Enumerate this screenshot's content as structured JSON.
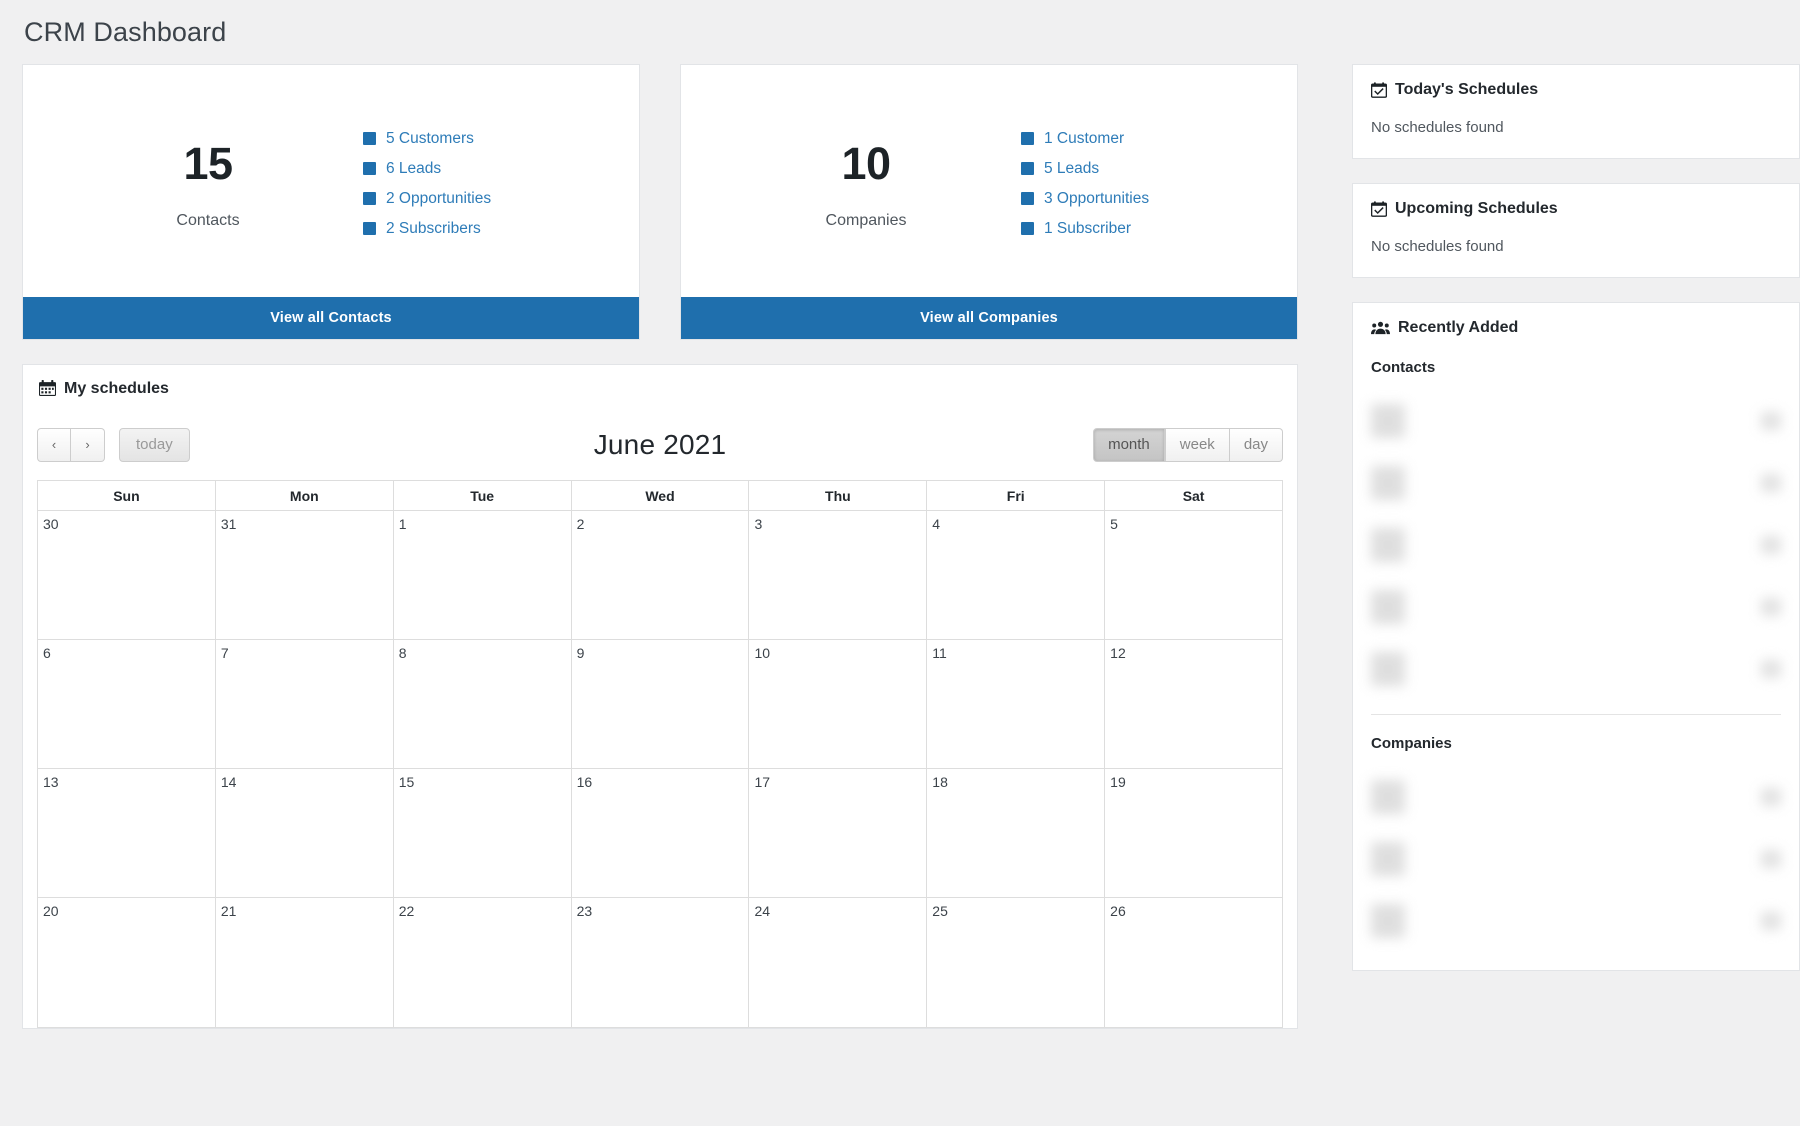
{
  "page": {
    "title": "CRM Dashboard"
  },
  "stats": [
    {
      "id": "contacts",
      "number": "15",
      "label": "Contacts",
      "legend": [
        {
          "text": "5 Customers",
          "color": "#1f6fad"
        },
        {
          "text": "6 Leads",
          "color": "#1f6fad"
        },
        {
          "text": "2 Opportunities",
          "color": "#1f6fad"
        },
        {
          "text": "2 Subscribers",
          "color": "#1f6fad"
        }
      ],
      "footer_label": "View all Contacts"
    },
    {
      "id": "companies",
      "number": "10",
      "label": "Companies",
      "legend": [
        {
          "text": "1 Customer",
          "color": "#1f6fad"
        },
        {
          "text": "5 Leads",
          "color": "#1f6fad"
        },
        {
          "text": "3 Opportunities",
          "color": "#1f6fad"
        },
        {
          "text": "1 Subscriber",
          "color": "#1f6fad"
        }
      ],
      "footer_label": "View all Companies"
    }
  ],
  "schedules_panel": {
    "title": "My schedules",
    "icon": "calendar-icon",
    "toolbar": {
      "prev_label": "‹",
      "next_label": "›",
      "today_label": "today",
      "title": "June 2021",
      "views": [
        {
          "label": "month",
          "active": true
        },
        {
          "label": "week",
          "active": false
        },
        {
          "label": "day",
          "active": false
        }
      ]
    },
    "calendar": {
      "weekday_headers": [
        "Sun",
        "Mon",
        "Tue",
        "Wed",
        "Thu",
        "Fri",
        "Sat"
      ],
      "weeks": [
        [
          "30",
          "31",
          "1",
          "2",
          "3",
          "4",
          "5"
        ],
        [
          "6",
          "7",
          "8",
          "9",
          "10",
          "11",
          "12"
        ],
        [
          "13",
          "14",
          "15",
          "16",
          "17",
          "18",
          "19"
        ],
        [
          "20",
          "21",
          "22",
          "23",
          "24",
          "25",
          "26"
        ]
      ]
    }
  },
  "sidebar": {
    "today_schedules": {
      "title": "Today's Schedules",
      "icon": "calendar-check-icon",
      "empty_text": "No schedules found"
    },
    "upcoming_schedules": {
      "title": "Upcoming Schedules",
      "icon": "calendar-check-icon",
      "empty_text": "No schedules found"
    },
    "recently_added": {
      "title": "Recently Added",
      "icon": "users-icon",
      "sections": [
        {
          "heading": "Contacts",
          "item_count": 5
        },
        {
          "heading": "Companies",
          "item_count": 3
        }
      ]
    }
  },
  "colors": {
    "accent": "#1f6fad",
    "link": "#2e7cb8",
    "page_bg": "#f0f0f1",
    "card_border": "#e2e4e7",
    "text_dark": "#23282d",
    "text_muted": "#50575e"
  }
}
